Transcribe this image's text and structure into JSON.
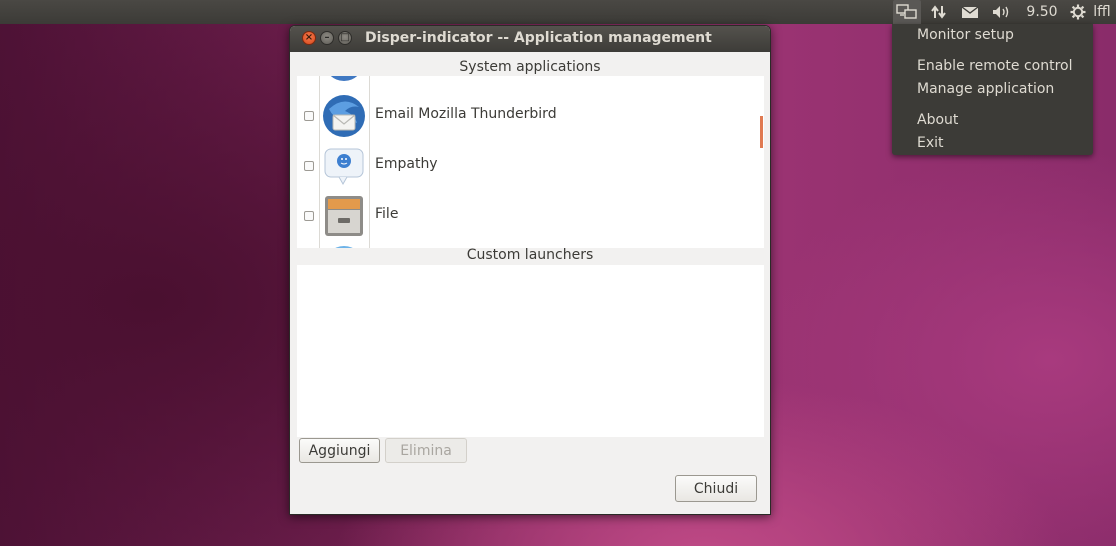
{
  "top_panel": {
    "clock": "9.50",
    "user": "lffl",
    "icons": [
      "disper-indicator-icon",
      "network-icon",
      "mail-icon",
      "volume-icon",
      "gear-icon"
    ]
  },
  "indicator_menu": {
    "items": [
      "Monitor setup",
      "Enable remote control",
      "Manage application",
      "About",
      "Exit"
    ]
  },
  "window": {
    "title": "Disper-indicator -- Application management",
    "system_section_label": "System applications",
    "custom_section_label": "Custom launchers",
    "system_apps": [
      {
        "name": "Email Mozilla Thunderbird",
        "checked": false,
        "icon": "thunderbird-icon"
      },
      {
        "name": "Empathy",
        "checked": false,
        "icon": "empathy-icon"
      },
      {
        "name": "File",
        "checked": false,
        "icon": "file-cabinet-icon"
      }
    ],
    "buttons": {
      "add": "Aggiungi",
      "remove": "Elimina",
      "close": "Chiudi"
    }
  },
  "colors": {
    "panel": "#3c3b37",
    "close_button": "#e05a2b",
    "scroll_accent": "#e07a52"
  }
}
